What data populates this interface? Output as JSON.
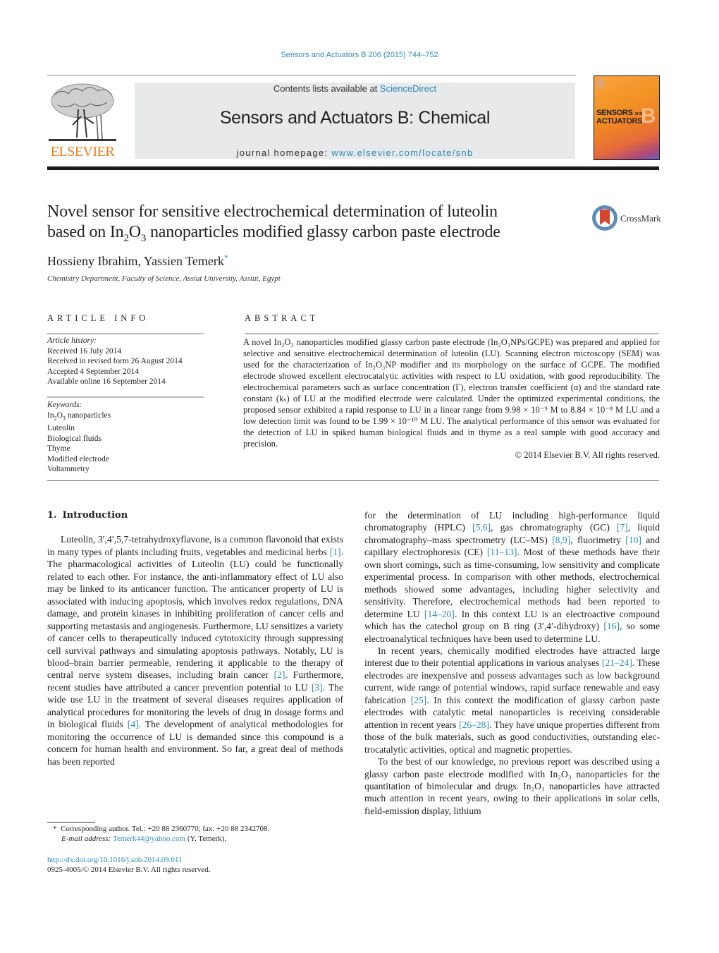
{
  "header": {
    "citation": "Sensors and Actuators B 206 (2015) 744–752",
    "contents_prefix": "Contents lists available at ",
    "contents_link": "ScienceDirect",
    "journal_name": "Sensors and Actuators B: Chemical",
    "homepage_prefix": "journal homepage: ",
    "homepage_link": "www.elsevier.com/locate/snb",
    "publisher_logo_text": "ELSEVIER",
    "cover_line1": "SENSORS",
    "cover_and": "and",
    "cover_line2": "ACTUATORS",
    "cover_letter": "B"
  },
  "article": {
    "title_line1": "Novel sensor for sensitive electrochemical determination of luteolin",
    "title_line2_pre": "based on In",
    "title_sub1": "2",
    "title_mid": "O",
    "title_sub2": "3",
    "title_line2_post": " nanoparticles modified glassy carbon paste electrode",
    "crossmark_label": "CrossMark",
    "authors": "Hossieny Ibrahim, Yassien Temerk",
    "author_mark": "*",
    "affiliation": "Chemistry Department, Faculty of Science, Assiut University, Assiut, Egypt"
  },
  "article_info": {
    "heading": "ARTICLE INFO",
    "history_label": "Article history:",
    "history": [
      "Received 16 July 2014",
      "Received in revised form 26 August 2014",
      "Accepted 4 September 2014",
      "Available online 16 September 2014"
    ],
    "keywords_label": "Keywords:",
    "keyword_first_pre": "In",
    "keyword_first_post": " nanoparticles",
    "keywords": [
      "Luteolin",
      "Biological fluids",
      "Thyme",
      "Modified electrode",
      "Voltammetry"
    ]
  },
  "abstract": {
    "heading": "ABSTRACT",
    "text": "A novel In₂O₃ nanoparticles modified glassy carbon paste electrode (In₂O₃NPs/GCPE) was prepared and applied for selective and sensitive electrochemical determination of luteolin (LU). Scanning electron microscopy (SEM) was used for the characterization of In₂O₃NP modifier and its morphology on the surface of GCPE. The modified electrode showed excellent electrocatalytic activities with respect to LU oxidation, with good reproducibility. The electrochemical parameters such as surface concentration (Γ), electron transfer coefficient (α) and the standard rate constant (kₛ) of LU at the modified electrode were calculated. Under the optimized experimental conditions, the proposed sensor exhibited a rapid response to LU in a linear range from 9.98 × 10⁻⁹ M to 8.84 × 10⁻⁸ M LU and a low detection limit was found to be 1.99 × 10⁻¹⁰ M LU. The analytical performance of this sensor was evaluated for the detection of LU in spiked human biological fluids and in thyme as a real sample with good accuracy and precision.",
    "copyright": "© 2014 Elsevier B.V. All rights reserved."
  },
  "body": {
    "section_number": "1.",
    "section_title": "Introduction",
    "left_p1": [
      {
        "t": "Luteolin, 3′,4′,5,7-tetrahydroxyflavone, is a common flavonoid that exists in many types of plants including fruits, vegetables and medicinal herbs "
      },
      {
        "ref": "[1]"
      },
      {
        "t": ". The pharmacological activities of Luteolin (LU) could be functionally related to each other. For instance, the anti-inflammatory effect of LU also may be linked to its anticancer function. The anticancer property of LU is associated with induc­ing apoptosis, which involves redox regulations, DNA damage, and protein kinases in inhibiting proliferation of cancer cells and sup­porting metastasis and angiogenesis. Furthermore, LU sensitizes a variety of cancer cells to therapeutically induced cytotoxicity through suppressing cell survival pathways and simulating apo­ptosis pathways. Notably, LU is blood–brain barrier permeable, rendering it applicable to the therapy of central nerve system diseases, including brain cancer "
      },
      {
        "ref": "[2]"
      },
      {
        "t": ". Furthermore, recent stud­ies have attributed a cancer prevention potential to LU "
      },
      {
        "ref": "[3]"
      },
      {
        "t": ". The wide use LU in the treatment of several diseases requires appli­cation of analytical procedures for monitoring the levels of drug in dosage forms and in biological fluids "
      },
      {
        "ref": "[4]"
      },
      {
        "t": ". The development of analytical methodologies for monitoring the occurrence of LU is demanded since this compound is a concern for human health and environment. So far, a great deal of methods has been reported"
      }
    ],
    "right_p1": [
      {
        "t": "for the determination of LU including high-performance liquid chromatography (HPLC) "
      },
      {
        "ref": "[5,6]"
      },
      {
        "t": ", gas chromatography (GC) "
      },
      {
        "ref": "[7]"
      },
      {
        "t": ", liquid chromatography–mass spectrometry (LC–MS) "
      },
      {
        "ref": "[8,9]"
      },
      {
        "t": ", fluorimetry "
      },
      {
        "ref": "[10]"
      },
      {
        "t": " and capillary electrophoresis (CE) "
      },
      {
        "ref": "[11–13]"
      },
      {
        "t": ". Most of these methods have their own short comings, such as time-consuming, low sensitivity and complicate experimental process. In compari­son with other methods, electrochemical methods showed some advantages, including higher selectivity and sensitivity. There­fore, electrochemical methods had been reported to determine LU "
      },
      {
        "ref": "[14–20]"
      },
      {
        "t": ". In this context LU is an electroactive compound which has the catechol group on B ring (3′,4′-dihydroxy) "
      },
      {
        "ref": "[16]"
      },
      {
        "t": ", so some electroanalytical techniques have been used to determine LU."
      }
    ],
    "right_p2": [
      {
        "t": "In recent years, chemically modified electrodes have attracted large interest due to their potential applications in various analyses "
      },
      {
        "ref": "[21–24]"
      },
      {
        "t": ". These electrodes are inexpensive and possess advantages such as low background current, wide range of potential windows, rapid surface renewable and easy fabrication "
      },
      {
        "ref": "[25]"
      },
      {
        "t": ". In this context the modification of glassy carbon paste electrodes with catalytic metal nanoparticles is receiving considerable attention in recent years "
      },
      {
        "ref": "[26–28]"
      },
      {
        "t": ". They have unique properties different from those of the bulk materials, such as good conductivities, outstanding elec­trocatalytic activities, optical and magnetic properties."
      }
    ],
    "right_p3": [
      {
        "t": "To the best of our knowledge, no previous report was described using a glassy carbon paste electrode modified with In₂O₃ nanoparticles for the quantitation of bimolecular and drugs. In₂O₃ nanoparticles have attracted much attention in recent years, owing to their applications in solar cells, field-emission display, lithium"
      }
    ]
  },
  "footnote": {
    "mark": "*",
    "text": "Corresponding author. Tel.: +20 88 2360770; fax: +20 88 2342708.",
    "email_label": "E-mail address: ",
    "email": "Temerk44@yahoo.com",
    "email_suffix": " (Y. Temerk).",
    "doi": "http://dx.doi.org/10.1016/j.snb.2014.09.011",
    "issn_line": "0925-4005/© 2014 Elsevier B.V. All rights reserved."
  },
  "colors": {
    "link": "#2a8ab8",
    "elsevier_orange": "#f07c1c",
    "masthead_bg": "#e8e9ea"
  }
}
